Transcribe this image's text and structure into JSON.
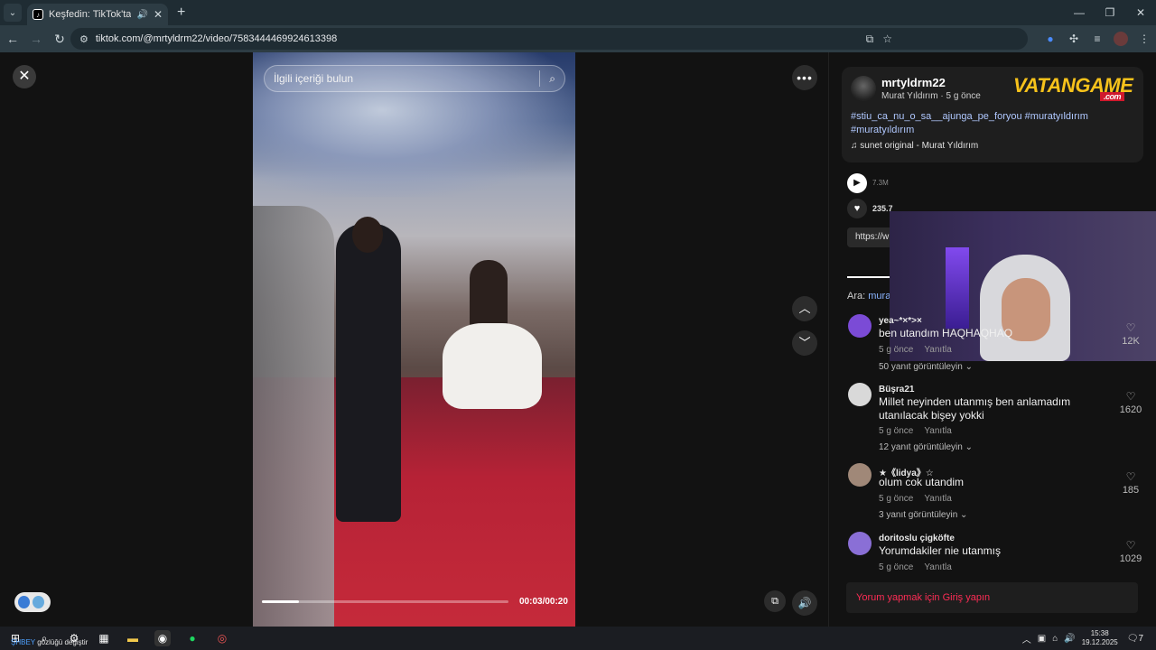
{
  "browser": {
    "tab_title": "Keşfedin: TikTok'ta favori vi",
    "url": "tiktok.com/@mrtyldrm22/video/7583444469924613398"
  },
  "video": {
    "search_placeholder": "İlgili içeriği bulun",
    "time": "00:03/00:20",
    "progress": 0.15
  },
  "post": {
    "username": "mrtyldrm22",
    "subline": "Murat Yıldırım · 5 g önce",
    "brand": "VATANGAME",
    "brand_suffix": ".com",
    "hashtags": "#stiu_ca_nu_o_sa__ajunga_pe_foryou #muratyıldırım #muratyıldırım",
    "music": "sunet original - Murat Yıldırım",
    "views": "7.3M",
    "likes": "235.7",
    "link": "https://w",
    "search_prefix": "Ara:",
    "search_term": "mura"
  },
  "comments": [
    {
      "user": "yea~*×*>×",
      "text": "ben utandım HAQHAQHAQ",
      "time": "5 g önce",
      "reply": "Yanıtla",
      "more": "50 yanıt görüntüleyin",
      "likes": "12K",
      "color": "#7b4bd6"
    },
    {
      "user": "Büşra21",
      "text": "Millet neyinden utanmış ben anlamadım utanılacak bişey yokki",
      "time": "5 g önce",
      "reply": "Yanıtla",
      "more": "12 yanıt görüntüleyin",
      "likes": "1620",
      "color": "#d9d9d9"
    },
    {
      "user": "★《lidya》☆",
      "text": "olum cok utandim",
      "time": "5 g önce",
      "reply": "Yanıtla",
      "more": "3 yanıt görüntüleyin",
      "likes": "185",
      "color": "#a08878"
    },
    {
      "user": "doritoslu çigköfte",
      "text": "Yorumdakiler nie utanmış",
      "time": "5 g önce",
      "reply": "Yanıtla",
      "more": "",
      "likes": "1029",
      "color": "#8a6fd6"
    }
  ],
  "login_prompt": "Yorum yapmak için Giriş yapın",
  "taskbar": {
    "label_blue": "ŞHBEY",
    "label": "gözlüğü değiştir",
    "time": "15:38",
    "date": "19.12.2025",
    "notifications": "7"
  }
}
